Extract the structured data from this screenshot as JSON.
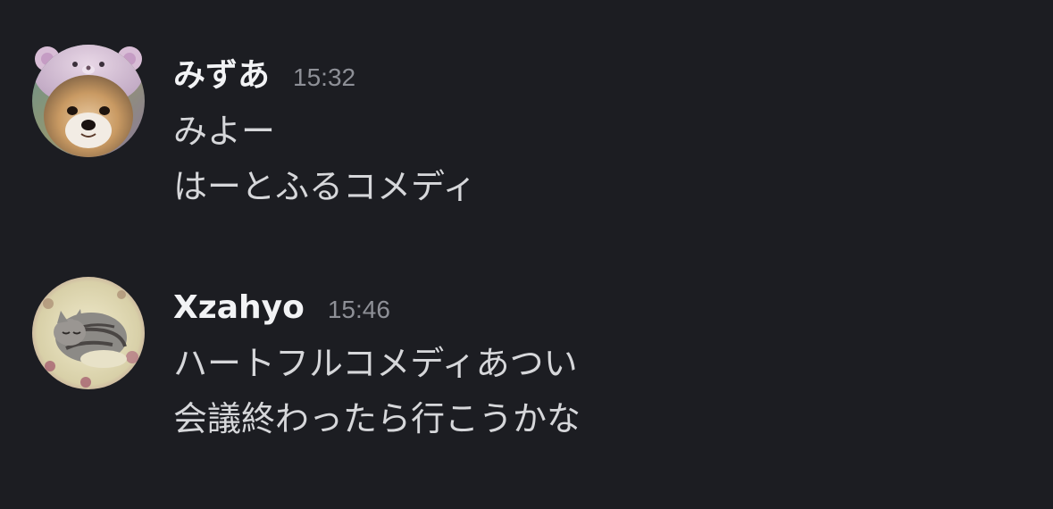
{
  "messages": [
    {
      "username": "みずあ",
      "timestamp": "15:32",
      "avatar_icon": "shiba-dog-bear-hood-avatar",
      "lines": [
        "みよー",
        "はーとふるコメディ"
      ]
    },
    {
      "username": "Xzahyo",
      "timestamp": "15:46",
      "avatar_icon": "sleeping-cat-avatar",
      "lines": [
        "ハートフルコメディあつい",
        "会議終わったら行こうかな"
      ]
    }
  ],
  "colors": {
    "background": "#1c1d22",
    "username": "#f2f3f5",
    "timestamp": "#8e9097",
    "message_text": "#d6d7da"
  }
}
